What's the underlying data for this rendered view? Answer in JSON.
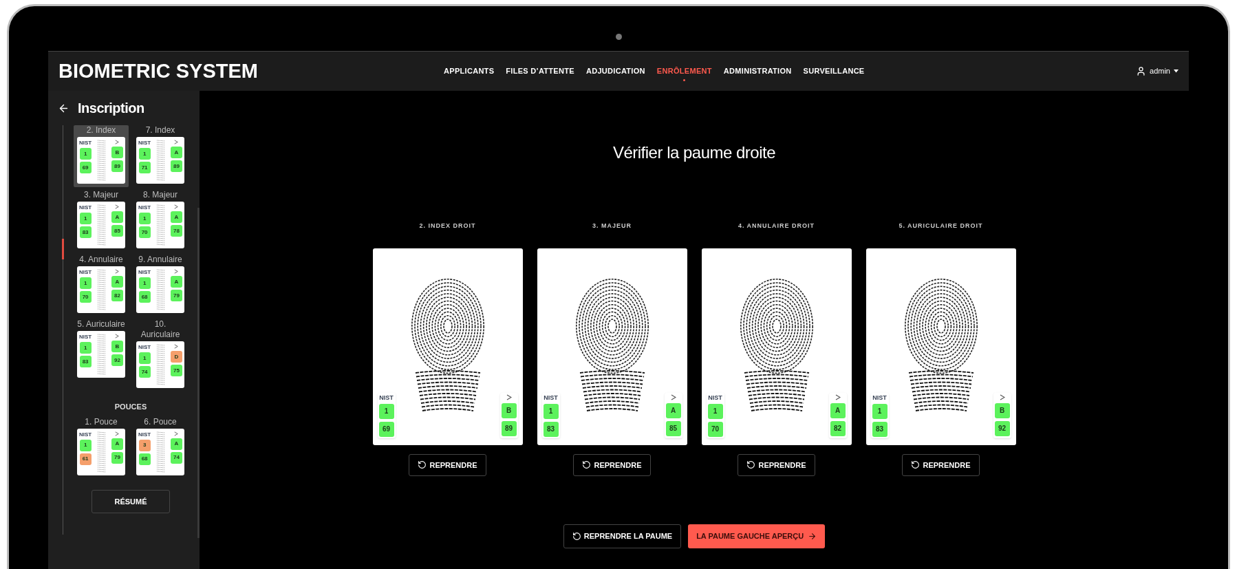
{
  "header": {
    "brand": "BIOMETRIC SYSTEM",
    "nav": [
      {
        "label": "APPLICANTS",
        "selected": false
      },
      {
        "label": "FILES D’ATTENTE",
        "selected": false
      },
      {
        "label": "ADJUDICATION",
        "selected": false
      },
      {
        "label": "ENRÔLEMENT",
        "selected": true
      },
      {
        "label": "ADMINISTRATION",
        "selected": false
      },
      {
        "label": "SURVEILLANCE",
        "selected": false
      }
    ],
    "user": "admin"
  },
  "sidebar": {
    "title": "Inscription",
    "groups": [
      {
        "fingers": [
          {
            "label": "2. Index",
            "selected": true,
            "nist_label": "NIST",
            "nist": [
              {
                "value": "1",
                "color": "#5cf25c"
              },
              {
                "value": "69",
                "color": "#5cf25c"
              }
            ],
            "grade": [
              {
                "value": "B",
                "color": "#5cf25c"
              },
              {
                "value": "89",
                "color": "#5cf25c"
              }
            ]
          },
          {
            "label": "7. Index",
            "selected": false,
            "nist_label": "NIST",
            "nist": [
              {
                "value": "1",
                "color": "#5cf25c"
              },
              {
                "value": "71",
                "color": "#5cf25c"
              }
            ],
            "grade": [
              {
                "value": "A",
                "color": "#5cf25c"
              },
              {
                "value": "89",
                "color": "#5cf25c"
              }
            ]
          },
          {
            "label": "3. Majeur",
            "selected": false,
            "nist_label": "NIST",
            "nist": [
              {
                "value": "1",
                "color": "#5cf25c"
              },
              {
                "value": "83",
                "color": "#5cf25c"
              }
            ],
            "grade": [
              {
                "value": "A",
                "color": "#5cf25c"
              },
              {
                "value": "85",
                "color": "#5cf25c"
              }
            ]
          },
          {
            "label": "8. Majeur",
            "selected": false,
            "nist_label": "NIST",
            "nist": [
              {
                "value": "1",
                "color": "#5cf25c"
              },
              {
                "value": "70",
                "color": "#5cf25c"
              }
            ],
            "grade": [
              {
                "value": "A",
                "color": "#5cf25c"
              },
              {
                "value": "78",
                "color": "#5cf25c"
              }
            ]
          },
          {
            "label": "4. Annulaire",
            "selected": false,
            "nist_label": "NIST",
            "nist": [
              {
                "value": "1",
                "color": "#5cf25c"
              },
              {
                "value": "70",
                "color": "#5cf25c"
              }
            ],
            "grade": [
              {
                "value": "A",
                "color": "#5cf25c"
              },
              {
                "value": "82",
                "color": "#5cf25c"
              }
            ]
          },
          {
            "label": "9. Annulaire",
            "selected": false,
            "nist_label": "NIST",
            "nist": [
              {
                "value": "1",
                "color": "#5cf25c"
              },
              {
                "value": "68",
                "color": "#5cf25c"
              }
            ],
            "grade": [
              {
                "value": "A",
                "color": "#5cf25c"
              },
              {
                "value": "79",
                "color": "#5cf25c"
              }
            ]
          },
          {
            "label": "5. Auriculaire",
            "selected": false,
            "nist_label": "NIST",
            "nist": [
              {
                "value": "1",
                "color": "#5cf25c"
              },
              {
                "value": "83",
                "color": "#5cf25c"
              }
            ],
            "grade": [
              {
                "value": "B",
                "color": "#5cf25c"
              },
              {
                "value": "92",
                "color": "#5cf25c"
              }
            ]
          },
          {
            "label": "10. Auriculaire",
            "selected": false,
            "nist_label": "NIST",
            "nist": [
              {
                "value": "1",
                "color": "#5cf25c"
              },
              {
                "value": "74",
                "color": "#5cf25c"
              }
            ],
            "grade": [
              {
                "value": "D",
                "color": "#f59f6b"
              },
              {
                "value": "75",
                "color": "#5cf25c"
              }
            ]
          }
        ]
      },
      {
        "heading": "POUCES",
        "fingers": [
          {
            "label": "1. Pouce",
            "selected": false,
            "nist_label": "NIST",
            "nist": [
              {
                "value": "1",
                "color": "#5cf25c"
              },
              {
                "value": "61",
                "color": "#f59f6b"
              }
            ],
            "grade": [
              {
                "value": "A",
                "color": "#5cf25c"
              },
              {
                "value": "79",
                "color": "#5cf25c"
              }
            ]
          },
          {
            "label": "6. Pouce",
            "selected": false,
            "nist_label": "NIST",
            "nist": [
              {
                "value": "3",
                "color": "#f59f6b"
              },
              {
                "value": "68",
                "color": "#5cf25c"
              }
            ],
            "grade": [
              {
                "value": "A",
                "color": "#5cf25c"
              },
              {
                "value": "74",
                "color": "#5cf25c"
              }
            ]
          }
        ]
      }
    ],
    "summary_button": "RÉSUMÉ"
  },
  "main": {
    "title": "Vérifier la paume droite",
    "cards": [
      {
        "label": "2. INDEX DROIT",
        "nist_label": "NIST",
        "nist": [
          {
            "value": "1",
            "color": "#5cf25c"
          },
          {
            "value": "69",
            "color": "#5cf25c"
          }
        ],
        "grade": [
          {
            "value": "B",
            "color": "#5cf25c"
          },
          {
            "value": "89",
            "color": "#5cf25c"
          }
        ],
        "retake": "REPRENDRE"
      },
      {
        "label": "3. MAJEUR",
        "nist_label": "NIST",
        "nist": [
          {
            "value": "1",
            "color": "#5cf25c"
          },
          {
            "value": "83",
            "color": "#5cf25c"
          }
        ],
        "grade": [
          {
            "value": "A",
            "color": "#5cf25c"
          },
          {
            "value": "85",
            "color": "#5cf25c"
          }
        ],
        "retake": "REPRENDRE"
      },
      {
        "label": "4. ANNULAIRE DROIT",
        "nist_label": "NIST",
        "nist": [
          {
            "value": "1",
            "color": "#5cf25c"
          },
          {
            "value": "70",
            "color": "#5cf25c"
          }
        ],
        "grade": [
          {
            "value": "A",
            "color": "#5cf25c"
          },
          {
            "value": "82",
            "color": "#5cf25c"
          }
        ],
        "retake": "REPRENDRE"
      },
      {
        "label": "5. AURICULAIRE DROIT",
        "nist_label": "NIST",
        "nist": [
          {
            "value": "1",
            "color": "#5cf25c"
          },
          {
            "value": "83",
            "color": "#5cf25c"
          }
        ],
        "grade": [
          {
            "value": "B",
            "color": "#5cf25c"
          },
          {
            "value": "92",
            "color": "#5cf25c"
          }
        ],
        "retake": "REPRENDRE"
      }
    ],
    "retake_palm": "REPRENDRE LA PAUME",
    "next": "LA PAUME GAUCHE APERÇU"
  }
}
